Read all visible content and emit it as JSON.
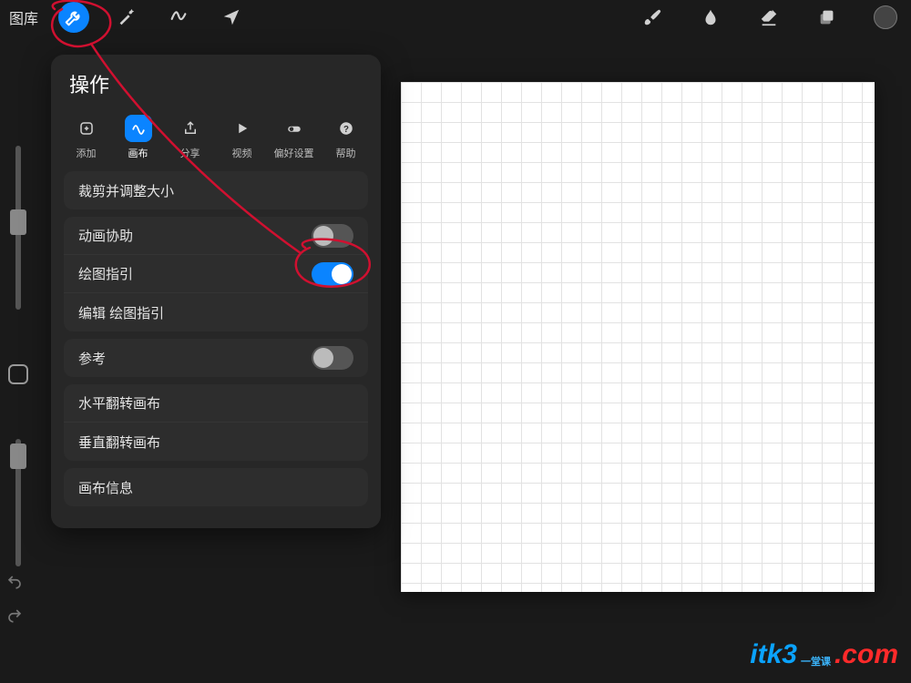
{
  "topbar": {
    "gallery": "图库",
    "icons": [
      "wrench",
      "wand",
      "s-curve",
      "send"
    ],
    "right_icons": [
      "brush",
      "smudge",
      "eraser",
      "layers",
      "color"
    ]
  },
  "panel": {
    "title": "操作",
    "tabs": [
      {
        "icon": "add",
        "label": "添加",
        "active": false
      },
      {
        "icon": "canvas",
        "label": "画布",
        "active": true
      },
      {
        "icon": "share",
        "label": "分享",
        "active": false
      },
      {
        "icon": "video",
        "label": "视频",
        "active": false
      },
      {
        "icon": "prefs",
        "label": "偏好设置",
        "active": false
      },
      {
        "icon": "help",
        "label": "帮助",
        "active": false
      }
    ],
    "rows": {
      "crop": "裁剪并调整大小",
      "anim": "动画协助",
      "guide": "绘图指引",
      "guide_edit": "编辑 绘图指引",
      "reference": "参考",
      "flip_h": "水平翻转画布",
      "flip_v": "垂直翻转画布",
      "info": "画布信息"
    },
    "toggles": {
      "anim": false,
      "guide": true,
      "reference": false
    }
  },
  "watermark": {
    "brand": "itk3",
    "suffix": ".com",
    "cn_top": "一堂课",
    "cn_bottom": ""
  },
  "annotation_color": "#d01030"
}
